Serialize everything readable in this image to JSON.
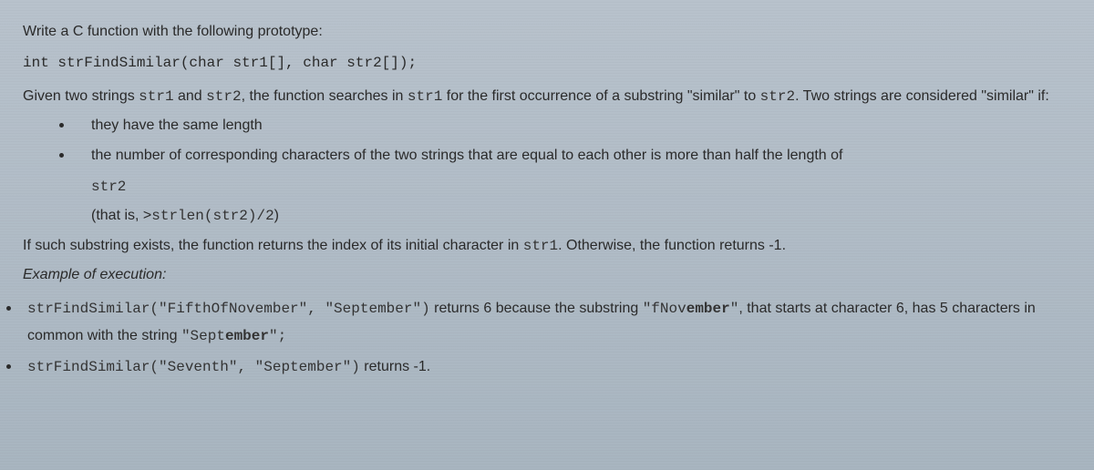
{
  "heading": "Write a C function with the following prototype:",
  "prototype": "int strFindSimilar(char str1[], char str2[]);",
  "intro_pre": "Given two strings ",
  "code_str1": "str1",
  "intro_and": " and ",
  "code_str2": "str2",
  "intro_mid": ", the function searches in ",
  "intro_post": " for the first occurrence of a substring \"similar\" to ",
  "intro_tail": ". Two strings are considered \"similar\" if:",
  "bullet1": "they have the same length",
  "bullet2": "the number of corresponding characters of the two strings that are equal to each other is more than half the length of ",
  "bullet2_code": "str2",
  "thatis_pre": "(that is, >",
  "thatis_code": "strlen(str2)/2",
  "thatis_post": ")",
  "result_pre": "If such substring exists, the function returns the index of its initial character in ",
  "result_post": ". Otherwise, the function returns -1.",
  "example_label": "Example of execution:",
  "ex1_code": "strFindSimilar(\"FifthOfNovember\", \"September\")",
  "ex1_mid1": " returns 6 because the substring ",
  "ex1_sub_pre": "\"fNov",
  "ex1_sub_bold": "ember",
  "ex1_sub_post": "\"",
  "ex1_mid2": ", that starts at character 6, has 5 characters in common with the string ",
  "ex1_str2_pre": "\"Sept",
  "ex1_str2_bold": "ember",
  "ex1_str2_post": "\";",
  "ex2_code": "strFindSimilar(\"Seventh\", \"September\")",
  "ex2_tail": " returns -1."
}
